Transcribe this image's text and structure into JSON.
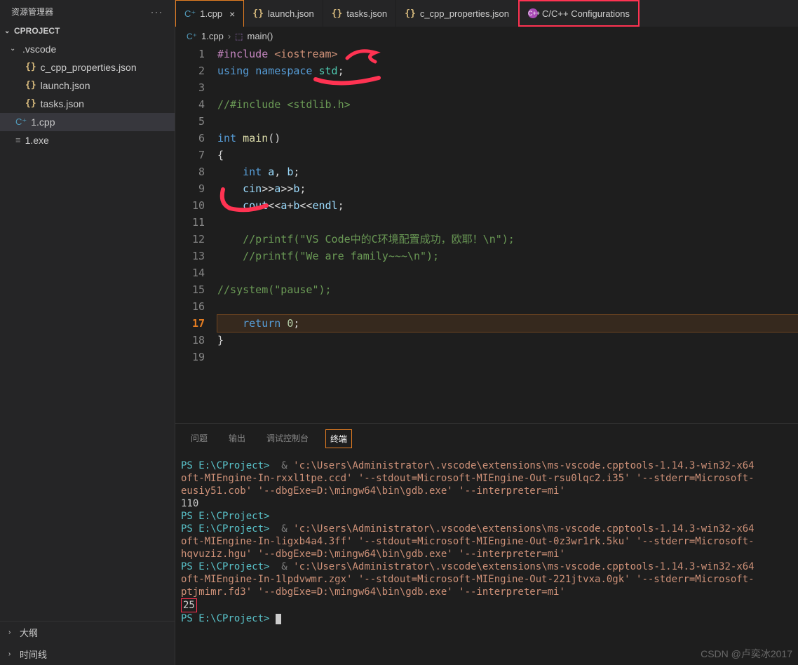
{
  "sidebar": {
    "title": "资源管理器",
    "project": "CPROJECT",
    "folder": ".vscode",
    "files": [
      {
        "name": "c_cpp_properties.json",
        "icon": "json"
      },
      {
        "name": "launch.json",
        "icon": "json"
      },
      {
        "name": "tasks.json",
        "icon": "json"
      }
    ],
    "rootFiles": [
      {
        "name": "1.cpp",
        "icon": "cpp"
      },
      {
        "name": "1.exe",
        "icon": "exe"
      }
    ],
    "outline": "大纲",
    "timeline": "时间线"
  },
  "tabs": [
    {
      "label": "1.cpp",
      "icon": "cpp",
      "active": true,
      "close": true
    },
    {
      "label": "launch.json",
      "icon": "json"
    },
    {
      "label": "tasks.json",
      "icon": "json"
    },
    {
      "label": "c_cpp_properties.json",
      "icon": "json"
    },
    {
      "label": "C/C++ Configurations",
      "icon": "cfg",
      "highlighted": true
    }
  ],
  "breadcrumb": {
    "file": "1.cpp",
    "symbol": "main()"
  },
  "code": {
    "lines": [
      {
        "n": 1,
        "html": "<span class='k-pre'>#include</span> <span class='k-inc'>&lt;iostream&gt;</span>"
      },
      {
        "n": 2,
        "html": "<span class='k-kw'>using</span> <span class='k-kw'>namespace</span> <span class='k-ns'>std</span><span class='k-op'>;</span>"
      },
      {
        "n": 3,
        "html": ""
      },
      {
        "n": 4,
        "html": "<span class='k-cmt'>//#include &lt;stdlib.h&gt;</span>"
      },
      {
        "n": 5,
        "html": ""
      },
      {
        "n": 6,
        "html": "<span class='k-type'>int</span> <span class='k-func'>main</span><span class='k-op'>()</span>"
      },
      {
        "n": 7,
        "html": "<span class='k-op'>{</span>"
      },
      {
        "n": 8,
        "html": "    <span class='k-type'>int</span> <span class='k-id'>a</span><span class='k-op'>,</span> <span class='k-id'>b</span><span class='k-op'>;</span>"
      },
      {
        "n": 9,
        "html": "    <span class='k-id'>cin</span><span class='k-op'>&gt;&gt;</span><span class='k-id'>a</span><span class='k-op'>&gt;&gt;</span><span class='k-id'>b</span><span class='k-op'>;</span>"
      },
      {
        "n": 10,
        "html": "    <span class='k-id'>cout</span><span class='k-op'>&lt;&lt;</span><span class='k-id'>a</span><span class='k-op'>+</span><span class='k-id'>b</span><span class='k-op'>&lt;&lt;</span><span class='k-id'>endl</span><span class='k-op'>;</span>"
      },
      {
        "n": 11,
        "html": ""
      },
      {
        "n": 12,
        "html": "    <span class='k-cmt'>//printf(\"VS Code中的C环境配置成功，欧耶！\\n\");</span>"
      },
      {
        "n": 13,
        "html": "    <span class='k-cmt'>//printf(\"We are family~~~\\n\");</span>"
      },
      {
        "n": 14,
        "html": ""
      },
      {
        "n": 15,
        "html": "<span class='k-cmt'>//system(\"pause\");</span>"
      },
      {
        "n": 16,
        "html": ""
      },
      {
        "n": 17,
        "hl": true,
        "html": "    <span class='k-kw'>return</span> <span class='k-num'>0</span><span class='k-op'>;</span>"
      },
      {
        "n": 18,
        "html": "<span class='k-op'>}</span>"
      },
      {
        "n": 19,
        "html": ""
      }
    ]
  },
  "panel": {
    "tabs": [
      "问题",
      "输出",
      "调试控制台",
      "终端"
    ],
    "activeTab": 3
  },
  "terminal": {
    "promptPath": "PS E:\\CProject>",
    "cmdPrefix": "&",
    "runs": [
      {
        "cmd": "'c:\\Users\\Administrator\\.vscode\\extensions\\ms-vscode.cpptools-1.14.3-win32-x64",
        "cont": [
          "oft-MIEngine-In-rxxl1tpe.ccd' '--stdout=Microsoft-MIEngine-Out-rsu0lqc2.i35' '--stderr=Microsoft-",
          "eusiy51.cob' '--dbgExe=D:\\mingw64\\bin\\gdb.exe' '--interpreter=mi'"
        ],
        "output": "110"
      },
      {
        "prompt": true
      },
      {
        "cmd": "'c:\\Users\\Administrator\\.vscode\\extensions\\ms-vscode.cpptools-1.14.3-win32-x64",
        "cont": [
          "oft-MIEngine-In-ligxb4a4.3ff' '--stdout=Microsoft-MIEngine-Out-0z3wr1rk.5ku' '--stderr=Microsoft-",
          "hqvuziz.hgu' '--dbgExe=D:\\mingw64\\bin\\gdb.exe' '--interpreter=mi'"
        ]
      },
      {
        "cmd": "'c:\\Users\\Administrator\\.vscode\\extensions\\ms-vscode.cpptools-1.14.3-win32-x64",
        "cont": [
          "oft-MIEngine-In-1lpdvwmr.zgx' '--stdout=Microsoft-MIEngine-Out-221jtvxa.0gk' '--stderr=Microsoft-",
          "ptjmimr.fd3' '--dbgExe=D:\\mingw64\\bin\\gdb.exe' '--interpreter=mi'"
        ],
        "output": "25",
        "boxOutput": true
      },
      {
        "prompt": true,
        "cursor": true
      }
    ]
  },
  "watermark": "CSDN @卢奕冰2017"
}
